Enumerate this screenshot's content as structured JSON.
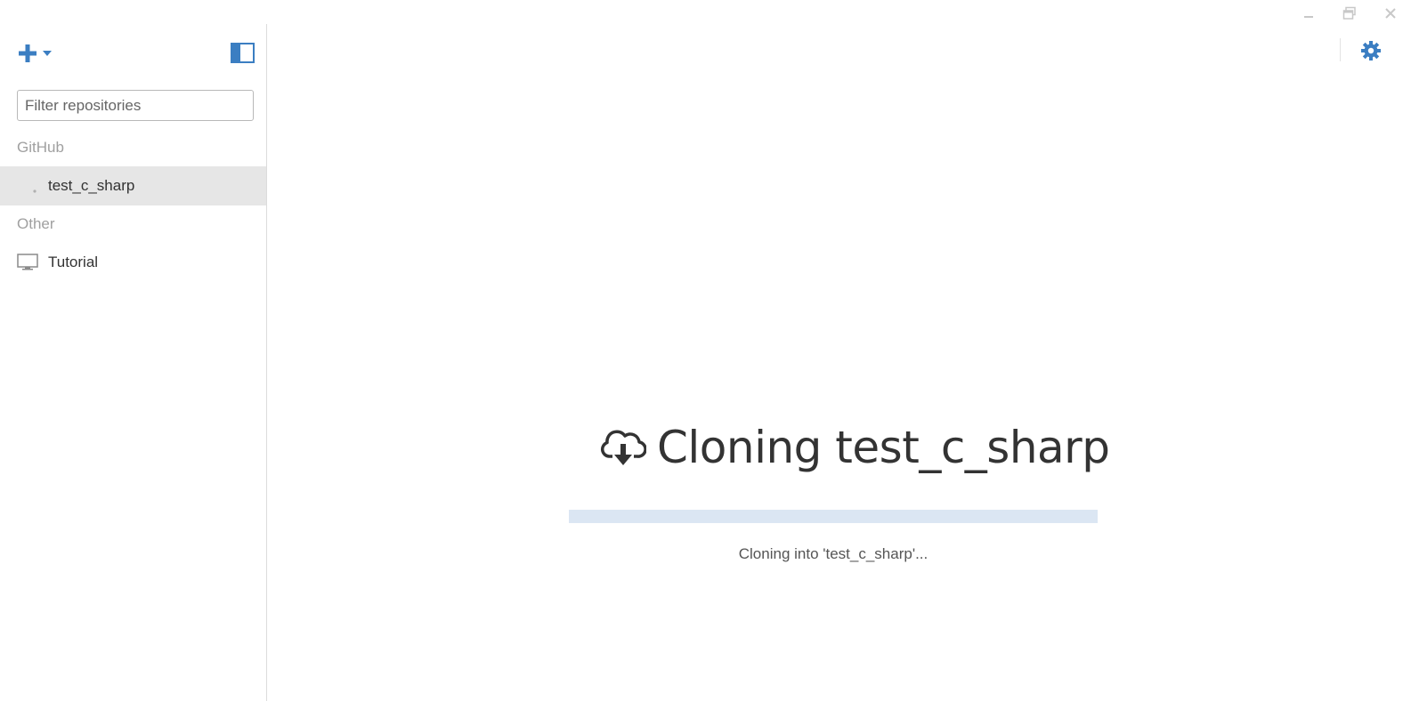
{
  "window": {
    "minimize_icon": "minimize-icon",
    "restore_icon": "restore-icon",
    "close_icon": "close-icon"
  },
  "sidebar": {
    "add_icon": "plus-icon",
    "toggle_icon": "sidebar-toggle-icon",
    "filter": {
      "placeholder": "Filter repositories",
      "value": ""
    },
    "sections": [
      {
        "header": "GitHub",
        "items": [
          {
            "label": "test_c_sharp",
            "icon": "spinner-icon",
            "selected": true
          }
        ]
      },
      {
        "header": "Other",
        "items": [
          {
            "label": "Tutorial",
            "icon": "monitor-icon",
            "selected": false
          }
        ]
      }
    ]
  },
  "toolbar": {
    "settings_icon": "gear-icon"
  },
  "main": {
    "title_icon": "cloud-download-icon",
    "title": "Cloning test_c_sharp",
    "progress": 0.0,
    "status": "Cloning into 'test_c_sharp'..."
  },
  "colors": {
    "accent": "#3b7ec2",
    "selected_bg": "#e6e6e6",
    "progress_track": "#dbe6f3",
    "section_header": "#a0a0a0"
  }
}
